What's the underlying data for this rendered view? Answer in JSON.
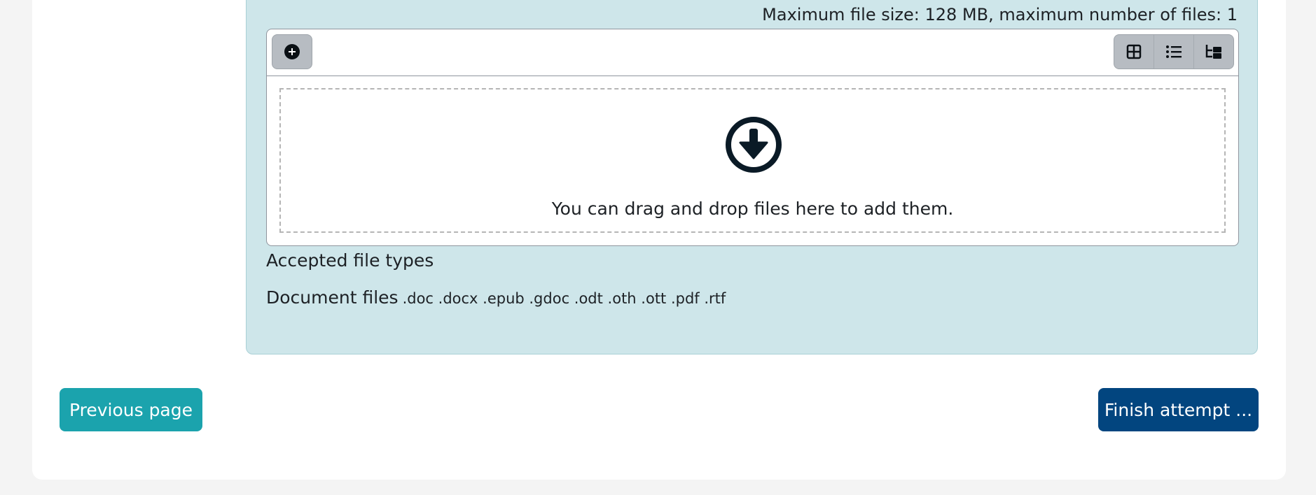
{
  "upload": {
    "max_size_text": "Maximum file size: 128 MB, maximum number of files: 1",
    "drop_text": "You can drag and drop files here to add them.",
    "toolbar": {
      "add_icon": "plus-circle-icon",
      "view_icons": [
        "grid-view-icon",
        "list-view-icon",
        "tree-view-icon"
      ]
    }
  },
  "accepted": {
    "title": "Accepted file types",
    "document_label": "Document files",
    "document_types": ".doc .docx .epub .gdoc .odt .oth .ott .pdf .rtf"
  },
  "nav": {
    "previous_label": "Previous page",
    "finish_label": "Finish attempt ..."
  },
  "colors": {
    "panel_bg": "#cee6ea",
    "previous_bg": "#1ba3ad",
    "finish_bg": "#02457f"
  }
}
